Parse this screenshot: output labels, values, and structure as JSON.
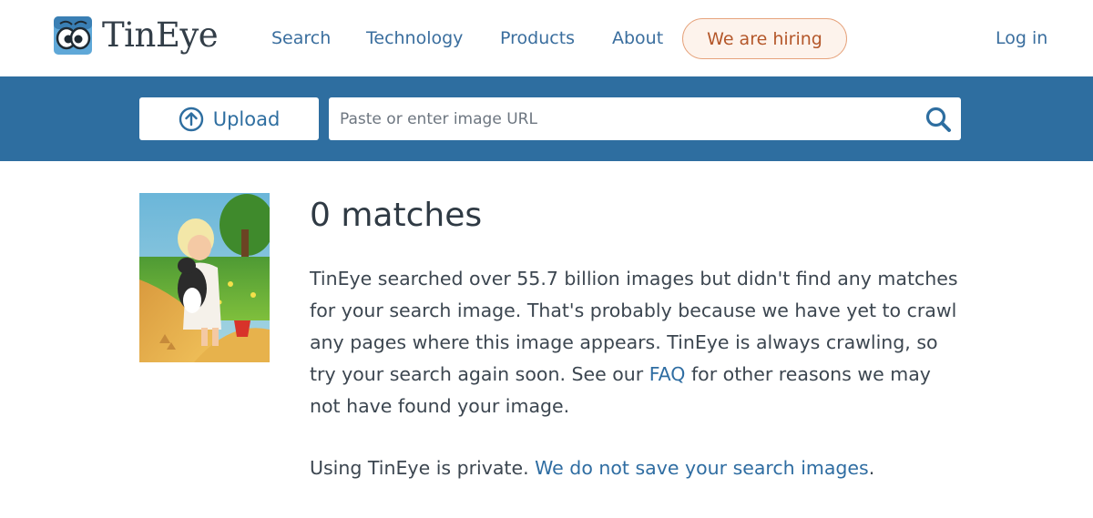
{
  "brand": {
    "name": "TinEye",
    "logo_icon": "tineye-eyes-logo-icon"
  },
  "nav": {
    "search": "Search",
    "technology": "Technology",
    "products": "Products",
    "about": "About",
    "hiring": "We are hiring",
    "login": "Log in"
  },
  "search_bar": {
    "upload_label": "Upload",
    "upload_icon": "upload-circle-arrow-icon",
    "url_placeholder": "Paste or enter image URL",
    "url_value": "",
    "search_icon": "magnifier-icon"
  },
  "result": {
    "title": "0 matches",
    "para_part1": "TinEye searched over 55.7 billion images but didn't find any matches for your search image. That's probably because we have yet to crawl any pages where this image appears. TinEye is always crawling, so try your search again soon. See our ",
    "faq_link": "FAQ",
    "para_part2": " for other reasons we may not have found your image.",
    "private_part1": "Using TinEye is private. ",
    "private_link": "We do not save your search images",
    "private_part2": "."
  },
  "colors": {
    "band": "#2e6ea0",
    "link": "#3a6e9e",
    "hiring_text": "#b4572a",
    "hiring_border": "#e6a37c",
    "hiring_bg": "#fdf3ec"
  }
}
